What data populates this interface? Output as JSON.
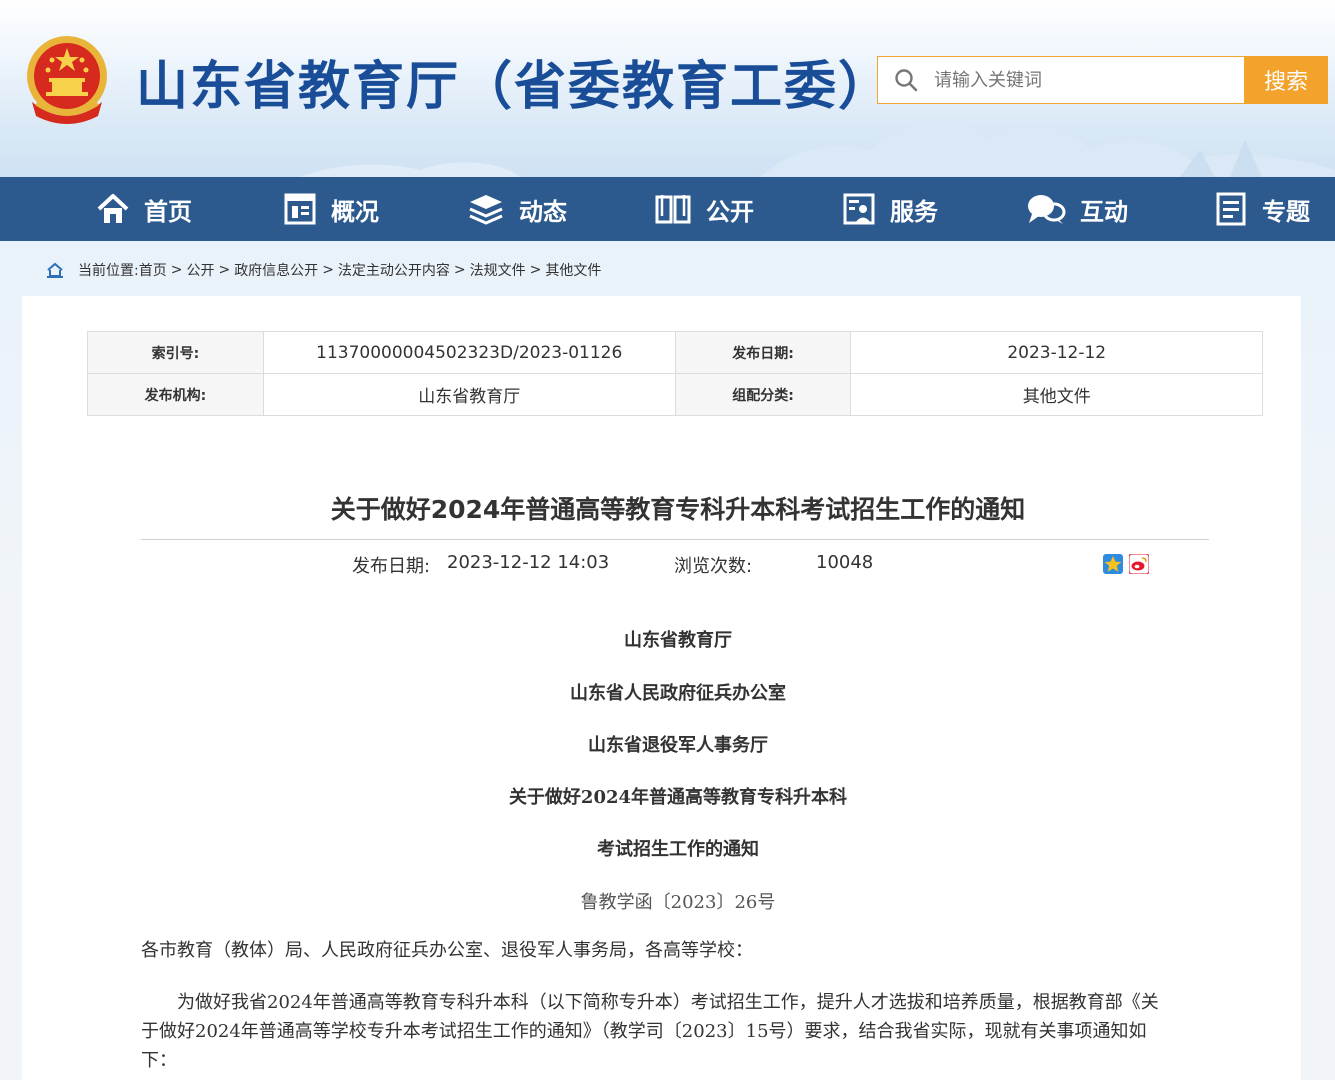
{
  "header": {
    "site_title": "山东省教育厅（省委教育工委）",
    "search_placeholder": "请输入关键词",
    "search_button": "搜索"
  },
  "nav": {
    "items": [
      {
        "label": "首页",
        "icon": "home-icon"
      },
      {
        "label": "概况",
        "icon": "building-icon"
      },
      {
        "label": "动态",
        "icon": "stack-icon"
      },
      {
        "label": "公开",
        "icon": "book-icon"
      },
      {
        "label": "服务",
        "icon": "service-icon"
      },
      {
        "label": "互动",
        "icon": "chat-icon"
      },
      {
        "label": "专题",
        "icon": "document-icon"
      }
    ]
  },
  "breadcrumb": {
    "prefix": "当前位置: ",
    "items": [
      "首页",
      "公开",
      "政府信息公开",
      "法定主动公开内容",
      "法规文件",
      "其他文件"
    ],
    "separator": ">"
  },
  "meta": {
    "index_label": "索引号:",
    "index_value": "11370000004502323D/2023-01126",
    "date_label": "发布日期:",
    "date_value": "2023-12-12",
    "org_label": "发布机构:",
    "org_value": "山东省教育厅",
    "category_label": "组配分类:",
    "category_value": "其他文件"
  },
  "article": {
    "title": "关于做好2024年普通高等教育专科升本科考试招生工作的通知",
    "publish_label": "发布日期:",
    "publish_value": "2023-12-12 14:03",
    "views_label": "浏览次数:",
    "views_value": "10048",
    "issuers": [
      "山东省教育厅",
      "山东省人民政府征兵办公室",
      "山东省退役军人事务厅"
    ],
    "doc_title_line1": "关于做好2024年普通高等教育专科升本科",
    "doc_title_line2": "考试招生工作的通知",
    "doc_number": "鲁教学函〔2023〕26号",
    "salutation": "各市教育（教体）局、人民政府征兵办公室、退役军人事务局，各高等学校：",
    "body_line1": "　　为做好我省2024年普通高等教育专科升本科（以下简称专升本）考试招生工作，提升人才选拔和培养质量，根据教育部《关",
    "body_line2": "于做好2024年普通高等学校专升本考试招生工作的通知》（教学司〔2023〕15号）要求，结合我省实际，现就有关事项通知如",
    "body_line3": "下："
  },
  "colors": {
    "nav_bg": "#2c5a8f",
    "title_blue": "#1a4d97",
    "search_orange": "#f3a22b"
  }
}
